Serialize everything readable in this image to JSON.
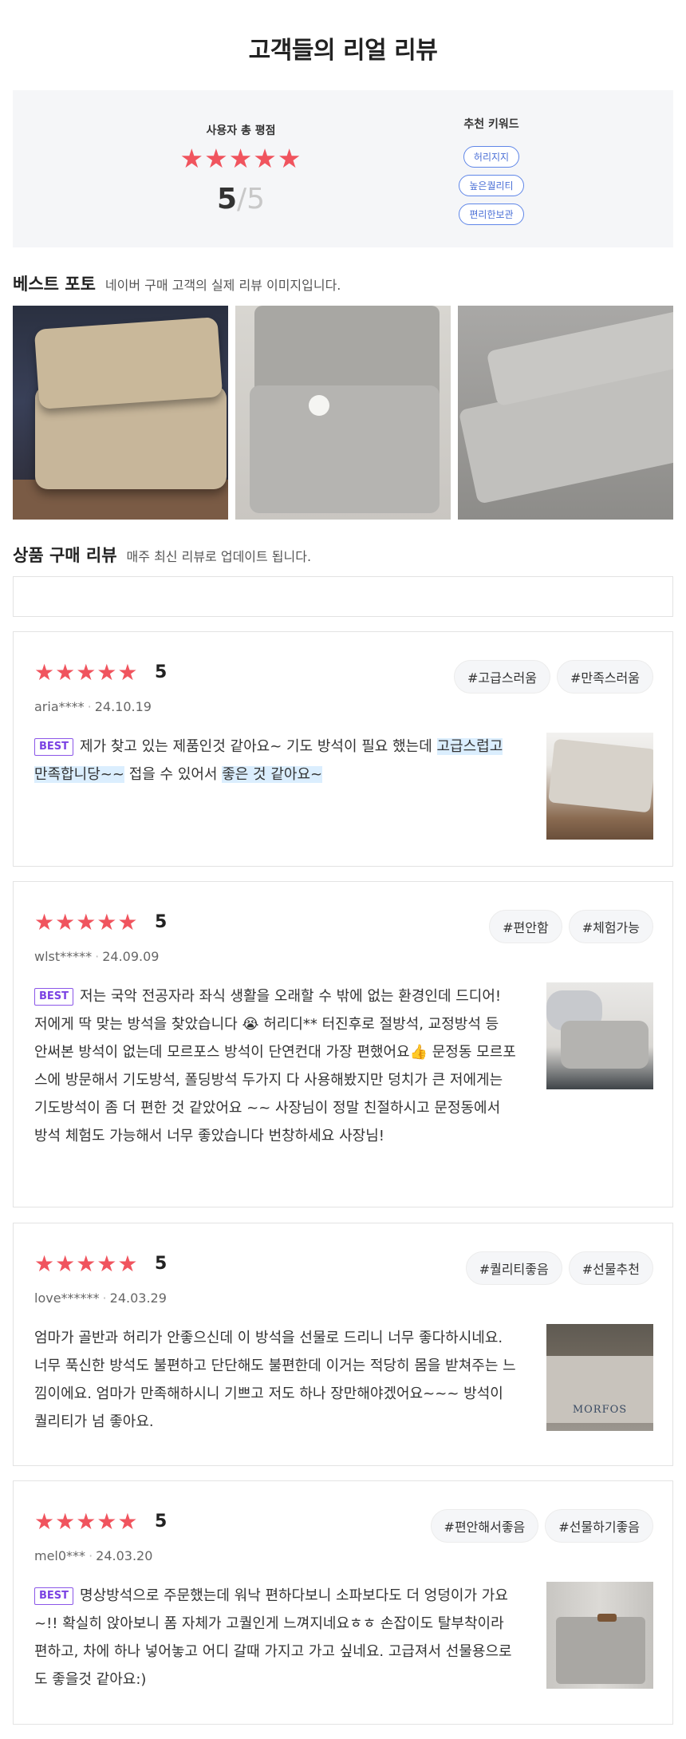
{
  "page_title": "고객들의 리얼 리뷰",
  "summary": {
    "rating_label": "사용자 총 평점",
    "stars": "★★★★★",
    "score": "5",
    "slash": "/",
    "max": "5",
    "keywords_title": "추천 키워드",
    "keywords": [
      "허리지지",
      "높은퀄리티",
      "편리한보관"
    ]
  },
  "best_photo": {
    "title": "베스트 포토",
    "subtitle": "네이버 구매 고객의 실제 리뷰 이미지입니다."
  },
  "reviews_section": {
    "title": "상품 구매 리뷰",
    "subtitle": "매주 최신 리뷰로 업데이트 됩니다."
  },
  "reviews": [
    {
      "stars": "★★★★★",
      "score": "5",
      "user": "aria****",
      "dot": "·",
      "date": "24.10.19",
      "tags": [
        "#고급스러움",
        "#만족스러움"
      ],
      "best": "BEST",
      "text_parts": [
        "제가 찾고 있는 제품인것 같아요~ 기도 방석이 필요 했는데 ",
        "고급스럽고 만족합니당~~",
        " 접을 수 있어서 ",
        "좋은 것 같아요~"
      ]
    },
    {
      "stars": "★★★★★",
      "score": "5",
      "user": "wlst*****",
      "dot": "·",
      "date": "24.09.09",
      "tags": [
        "#편안함",
        "#체험가능"
      ],
      "best": "BEST",
      "text": "저는 국악 전공자라 좌식 생활을 오래할 수 밖에 없는 환경인데 드디어! 저에게 딱 맞는 방석을 찾았습니다 😭 허리디** 터진후로 절방석, 교정방석 등 안써본 방석이 없는데 모르포스 방석이 단연컨대 가장 편했어요👍 문정동 모르포스에 방문해서 기도방석, 폴딩방석 두가지 다 사용해봤지만 덩치가 큰 저에게는 기도방석이 좀 더 편한 것 같았어요 ~~ 사장님이 정말 친절하시고 문정동에서 방석 체험도 가능해서 너무 좋았습니다 번창하세요 사장님!"
    },
    {
      "stars": "★★★★★",
      "score": "5",
      "user": "love******",
      "dot": "·",
      "date": "24.03.29",
      "tags": [
        "#퀄리티좋음",
        "#선물추천"
      ],
      "text": "엄마가 골반과 허리가 안좋으신데 이 방석을 선물로 드리니 너무 좋다하시네요. 너무 푹신한 방석도 불편하고 단단해도 불편한데 이거는 적당히 몸을 받쳐주는 느낌이에요. 엄마가 만족해하시니 기쁘고 저도 하나 장만해야겠어요~~~ 방석이 퀄리티가 넘 좋아요.",
      "thumb_logo": "MORFOS"
    },
    {
      "stars": "★★★★★",
      "score": "5",
      "user": "mel0***",
      "dot": "·",
      "date": "24.03.20",
      "tags": [
        "#편안해서좋음",
        "#선물하기좋음"
      ],
      "best": "BEST",
      "text": "명상방석으로 주문했는데 워낙 편하다보니 소파보다도 더 엉덩이가 가요~!! 확실히 앉아보니 폼 자체가 고퀄인게 느껴지네요ㅎㅎ 손잡이도 탈부착이라 편하고, 차에 하나 넣어놓고 어디 갈때 가지고 가고 싶네요. 고급져서 선물용으로도 좋을것 같아요:)"
    }
  ],
  "colors": {
    "star": "#f0545e",
    "keyword_border": "#5f86e8",
    "best_badge": "#8b56e8",
    "highlight": "#dbeefe"
  }
}
